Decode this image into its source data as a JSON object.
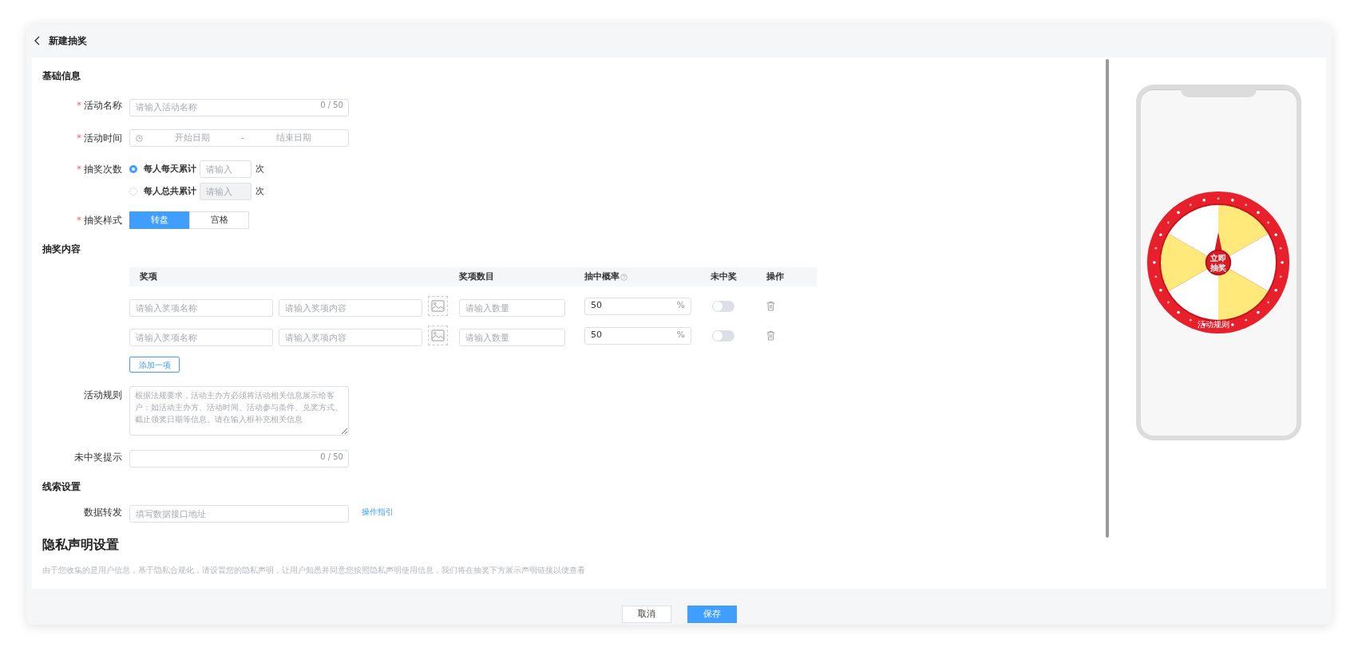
{
  "header": {
    "title": "新建抽奖"
  },
  "basic": {
    "title": "基础信息",
    "name": {
      "label": "活动名称",
      "required_mark": "*",
      "placeholder": "请输入活动名称",
      "counter": "0 / 50"
    },
    "time": {
      "label": "活动时间",
      "required_mark": "*",
      "start": "开始日期",
      "separator": "-",
      "end": "结束日期"
    },
    "draw_count": {
      "label": "抽奖次数",
      "required_mark": "*",
      "options": [
        {
          "label": "每人每天累计",
          "selected": true,
          "placeholder": "请输入",
          "unit": "次"
        },
        {
          "label": "每人总共累计",
          "selected": false,
          "placeholder": "请输入",
          "unit": "次"
        }
      ]
    },
    "style": {
      "label": "抽奖样式",
      "required_mark": "*",
      "options": [
        {
          "label": "转盘",
          "selected": true
        },
        {
          "label": "宫格",
          "selected": false
        }
      ]
    }
  },
  "prizes": {
    "title": "抽奖内容",
    "columns": [
      "奖项",
      "奖项数目",
      "抽中概率",
      "未中奖",
      "操作"
    ],
    "rows": [
      {
        "name_placeholder": "请输入奖项名称",
        "content_placeholder": "请输入奖项内容",
        "count_placeholder": "请输入数量",
        "probability": "50",
        "unit": "%",
        "no_prize": false
      },
      {
        "name_placeholder": "请输入奖项名称",
        "content_placeholder": "请输入奖项内容",
        "count_placeholder": "请输入数量",
        "probability": "50",
        "unit": "%",
        "no_prize": false
      }
    ],
    "add_button": "添加一项",
    "rules": {
      "label": "活动规则",
      "placeholder": "根据法规要求，活动主办方必须将活动相关信息展示给客户：如活动主办方、活动时间、活动参与条件、兑奖方式、截止领奖日期等信息。请在输入框补充相关信息"
    },
    "miss_tip": {
      "label": "未中奖提示",
      "counter": "0 / 50"
    }
  },
  "leads": {
    "title": "线索设置",
    "label": "数据转发",
    "placeholder": "填写数据接口地址",
    "link": "操作指引"
  },
  "privacy": {
    "title": "隐私声明设置",
    "description": "由于您收集的是用户信息，基于隐私合规化，请设置您的隐私声明，让用户知悉并同意您按照隐私声明使用信息，我们将在抽奖下方展示声明链接以便查看"
  },
  "preview": {
    "center_lines": [
      "立即",
      "抽奖"
    ],
    "rules_label": "活动规则"
  },
  "footer": {
    "buttons": [
      {
        "label": "取消",
        "kind": "secondary"
      },
      {
        "label": "保存",
        "kind": "primary"
      }
    ]
  }
}
